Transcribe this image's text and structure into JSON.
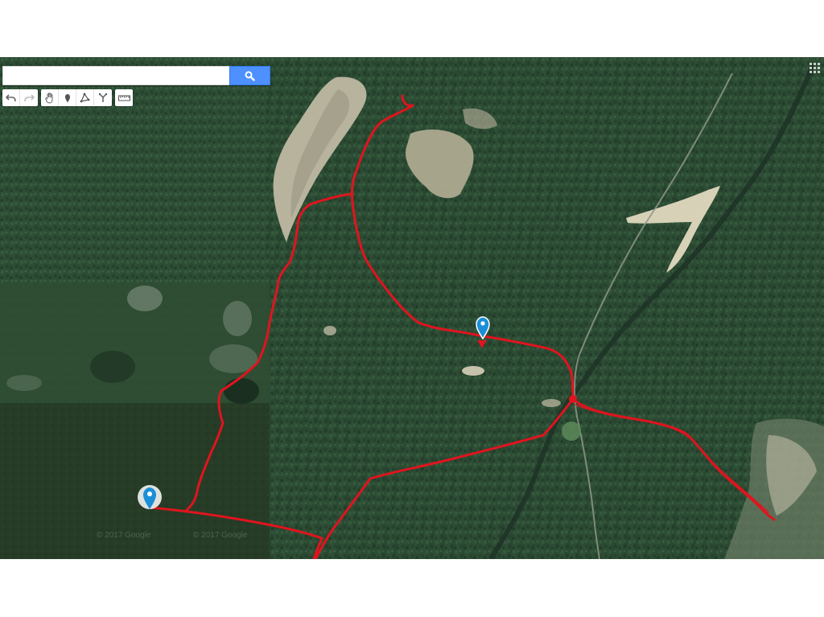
{
  "search": {
    "value": "",
    "placeholder": ""
  },
  "toolbar": {
    "groups": [
      [
        "undo-icon",
        "redo-icon"
      ],
      [
        "hand-pan-icon",
        "marker-icon",
        "polygon-icon",
        "route-icon"
      ],
      [
        "ruler-icon"
      ]
    ]
  },
  "map": {
    "type": "satellite",
    "route_color": "#e0141e",
    "marker_color": "#1a8fd8",
    "copyright_1": "© 2017 Google",
    "copyright_2": "© 2017 Google"
  }
}
